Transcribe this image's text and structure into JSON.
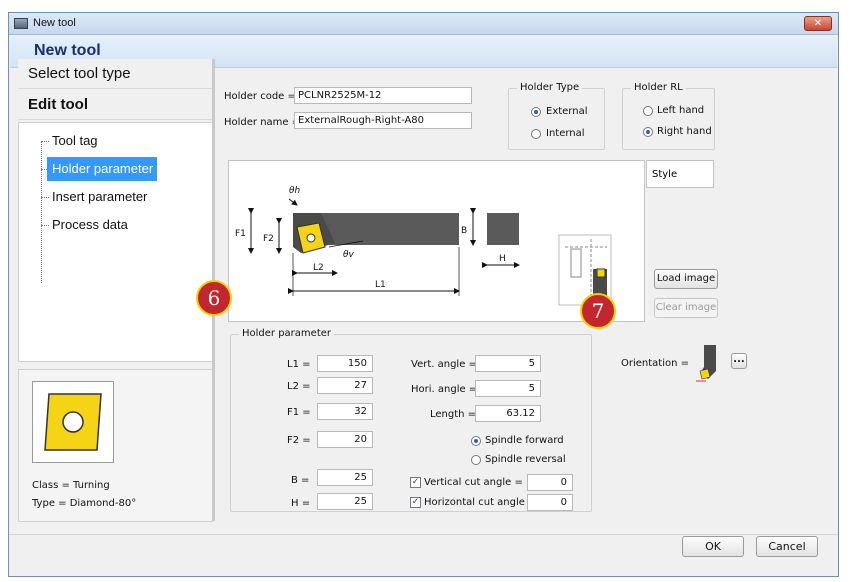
{
  "window": {
    "title": "New tool",
    "close_symbol": "✕"
  },
  "header": {
    "heading": "New tool"
  },
  "nav": {
    "select_tool_type": "Select tool type",
    "edit_tool": "Edit tool",
    "tree": [
      "Tool tag",
      "Holder parameter",
      "Insert parameter",
      "Process data"
    ],
    "selected_index": 1
  },
  "insert_info": {
    "class_text": "Class = Turning",
    "type_text": "Type = Diamond-80°"
  },
  "holder": {
    "code_label": "Holder code =",
    "code_value": "PCLNR2525M-12",
    "name_label": "Holder name =",
    "name_value": "ExternalRough-Right-A80"
  },
  "holder_type": {
    "title": "Holder Type",
    "options": [
      "External",
      "Internal"
    ],
    "selected": "External"
  },
  "holder_rl": {
    "title": "Holder RL",
    "options": [
      "Left hand",
      "Right hand"
    ],
    "selected": "Right hand"
  },
  "diagram": {
    "labels": {
      "theta_h": "θh",
      "theta_v": "θv",
      "F1": "F1",
      "F2": "F2",
      "L1": "L1",
      "L2": "L2",
      "B": "B",
      "H": "H"
    },
    "colors": {
      "holder": "#5a5a5a",
      "insert": "#f5d416",
      "dim": "#111111"
    }
  },
  "style_label": "Style",
  "buttons": {
    "load_image": "Load image",
    "clear_image": "Clear image",
    "more": "...",
    "ok": "OK",
    "cancel": "Cancel"
  },
  "params": {
    "title": "Holder parameter",
    "L1_label": "L1 =",
    "L1": "150",
    "L2_label": "L2 =",
    "L2": "27",
    "F1_label": "F1 =",
    "F1": "32",
    "F2_label": "F2 =",
    "F2": "20",
    "B_label": "B =",
    "B": "25",
    "H_label": "H =",
    "H": "25",
    "vert_label": "Vert. angle =",
    "vert": "5",
    "hori_label": "Hori. angle =",
    "hori": "5",
    "length_label": "Length =",
    "length": "63.12",
    "spindle_forward": "Spindle forward",
    "spindle_reversal": "Spindle reversal",
    "spindle_selected": "Spindle forward",
    "vcut_label": "Vertical cut angle =",
    "vcut": "0",
    "hcut_label": "Horizontal cut angle =",
    "hcut": "0",
    "vcut_checked": true,
    "hcut_checked": true,
    "check_mark": "✓"
  },
  "orientation_label": "Orientation =",
  "badges": [
    "6",
    "7"
  ]
}
